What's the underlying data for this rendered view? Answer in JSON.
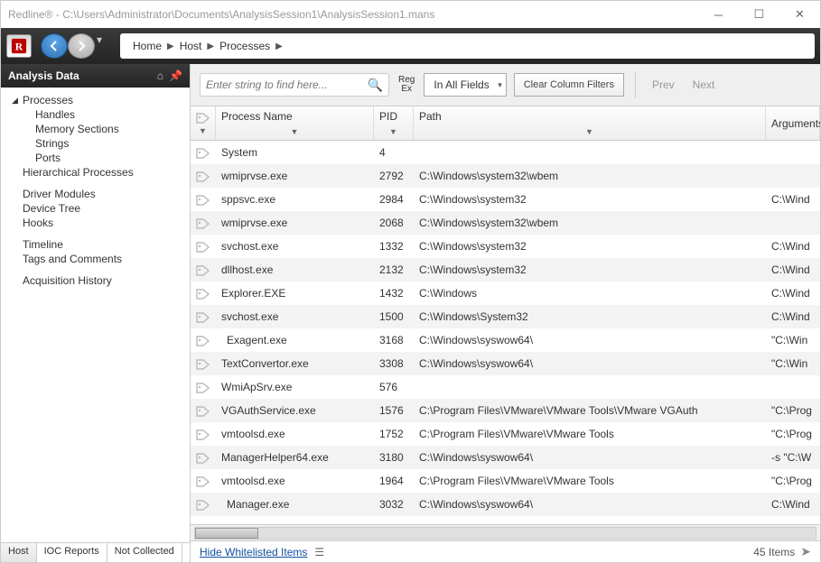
{
  "window": {
    "title": "Redline® - C:\\Users\\Administrator\\Documents\\AnalysisSession1\\AnalysisSession1.mans"
  },
  "breadcrumb": [
    "Home",
    "Host",
    "Processes"
  ],
  "sidebar": {
    "title": "Analysis Data",
    "items": [
      {
        "label": "Processes",
        "level": 1,
        "expanded": true
      },
      {
        "label": "Handles",
        "level": 2
      },
      {
        "label": "Memory Sections",
        "level": 2
      },
      {
        "label": "Strings",
        "level": 2
      },
      {
        "label": "Ports",
        "level": 2
      },
      {
        "label": "Hierarchical Processes",
        "level": 1
      },
      {
        "label": "",
        "level": 0,
        "spacer": true
      },
      {
        "label": "Driver Modules",
        "level": 1
      },
      {
        "label": "Device Tree",
        "level": 1
      },
      {
        "label": "Hooks",
        "level": 1
      },
      {
        "label": "",
        "level": 0,
        "spacer": true
      },
      {
        "label": "Timeline",
        "level": 1
      },
      {
        "label": "Tags and Comments",
        "level": 1
      },
      {
        "label": "",
        "level": 0,
        "spacer": true
      },
      {
        "label": "Acquisition History",
        "level": 1
      }
    ],
    "tabs": [
      "Host",
      "IOC Reports",
      "Not Collected"
    ]
  },
  "toolbar": {
    "search_placeholder": "Enter string to find here...",
    "regex_label_line1": "Reg",
    "regex_label_line2": "Ex",
    "field_filter": "In All Fields",
    "clear_filters": "Clear Column Filters",
    "prev": "Prev",
    "next": "Next"
  },
  "columns": {
    "name": "Process Name",
    "pid": "PID",
    "path": "Path",
    "args": "Arguments"
  },
  "rows": [
    {
      "name": "System",
      "pid": "4",
      "path": "",
      "args": ""
    },
    {
      "name": "wmiprvse.exe",
      "pid": "2792",
      "path": "C:\\Windows\\system32\\wbem",
      "args": ""
    },
    {
      "name": "sppsvc.exe",
      "pid": "2984",
      "path": "C:\\Windows\\system32",
      "args": "C:\\Wind"
    },
    {
      "name": "wmiprvse.exe",
      "pid": "2068",
      "path": "C:\\Windows\\system32\\wbem",
      "args": ""
    },
    {
      "name": "svchost.exe",
      "pid": "1332",
      "path": "C:\\Windows\\system32",
      "args": "C:\\Wind"
    },
    {
      "name": "dllhost.exe",
      "pid": "2132",
      "path": "C:\\Windows\\system32",
      "args": "C:\\Wind"
    },
    {
      "name": "Explorer.EXE",
      "pid": "1432",
      "path": "C:\\Windows",
      "args": "C:\\Wind"
    },
    {
      "name": "svchost.exe",
      "pid": "1500",
      "path": "C:\\Windows\\System32",
      "args": "C:\\Wind"
    },
    {
      "name": "Exagent.exe",
      "pid": "3168",
      "path": "C:\\Windows\\syswow64\\",
      "args": "\"C:\\Win",
      "indent": true
    },
    {
      "name": "TextConvertor.exe",
      "pid": "3308",
      "path": "C:\\Windows\\syswow64\\",
      "args": "\"C:\\Win"
    },
    {
      "name": "WmiApSrv.exe",
      "pid": "576",
      "path": "",
      "args": ""
    },
    {
      "name": "VGAuthService.exe",
      "pid": "1576",
      "path": "C:\\Program Files\\VMware\\VMware Tools\\VMware VGAuth",
      "args": "\"C:\\Prog"
    },
    {
      "name": "vmtoolsd.exe",
      "pid": "1752",
      "path": "C:\\Program Files\\VMware\\VMware Tools",
      "args": "\"C:\\Prog"
    },
    {
      "name": "ManagerHelper64.exe",
      "pid": "3180",
      "path": "C:\\Windows\\syswow64\\",
      "args": "-s \"C:\\W"
    },
    {
      "name": "vmtoolsd.exe",
      "pid": "1964",
      "path": "C:\\Program Files\\VMware\\VMware Tools",
      "args": "\"C:\\Prog"
    },
    {
      "name": "Manager.exe",
      "pid": "3032",
      "path": "C:\\Windows\\syswow64\\",
      "args": "C:\\Wind",
      "indent": true
    }
  ],
  "status": {
    "hide_link": "Hide Whitelisted Items",
    "count": "45 Items"
  }
}
